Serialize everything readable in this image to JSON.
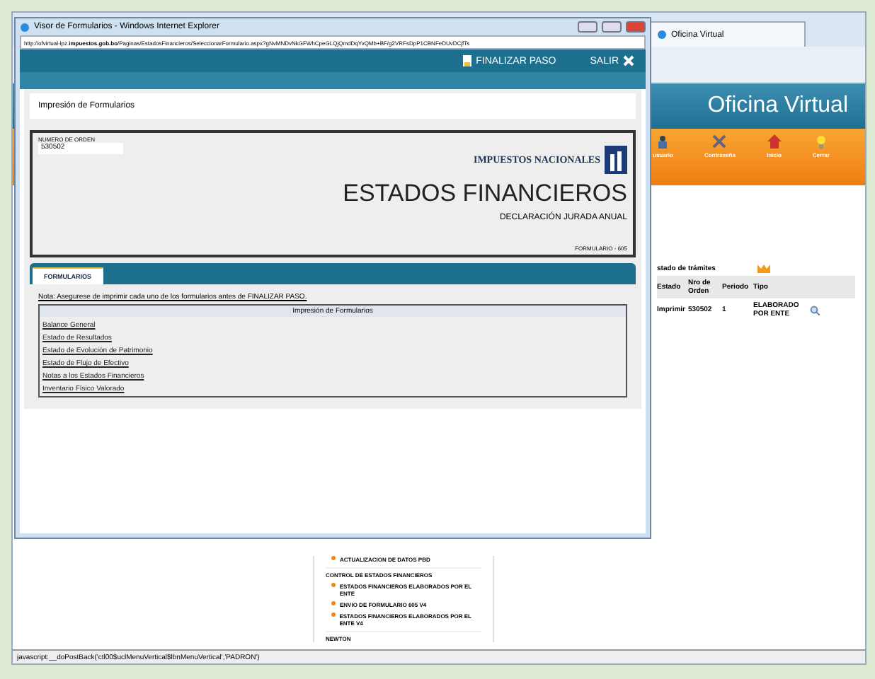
{
  "browser": {
    "tab": "Oficina Virtual",
    "banner": "Oficina Virtual",
    "menu": [
      {
        "label": "usuario",
        "kind": "user"
      },
      {
        "label": "Contraseña",
        "kind": "key"
      },
      {
        "label": "Inicio",
        "kind": "home"
      },
      {
        "label": "Cerrar",
        "kind": "exit"
      }
    ],
    "table": {
      "title": "stado de trámites",
      "columns": [
        "Estado",
        "Nro de Orden",
        "Periodo",
        "Tipo"
      ],
      "rows": [
        [
          "Imprimir",
          "530502",
          "1",
          "ELABORADO POR ENTE"
        ]
      ]
    },
    "sidebar": [
      {
        "label": "ACTUALIZACION DE DATOS PBD",
        "kind": "item"
      },
      {
        "label": "CONTROL DE ESTADOS FINANCIEROS",
        "kind": "header"
      },
      {
        "label": "ESTADOS FINANCIEROS ELABORADOS POR EL ENTE",
        "kind": "item"
      },
      {
        "label": "ENVIO DE FORMULARIO 605 V4",
        "kind": "item"
      },
      {
        "label": "ESTADOS FINANCIEROS ELABORADOS POR EL ENTE V4",
        "kind": "item"
      },
      {
        "label": "NEWTON",
        "kind": "header"
      }
    ],
    "status_bar": "javascript:__doPostBack('ctl00$uclMenuVertical$lbnMenuVertical','PADRON')"
  },
  "popup": {
    "title": "Visor de Formularios - Windows Internet Explorer",
    "address": "http://ofvirtual-lpz.**impuestos.gob.bo**/Paginas/EstadosFinancieros/SeleccionarFormulario.aspx?gNvMNDvNkGFWhCpeGLQjQmdDqYvQMb+BF/g2VRFsDpP1CBNFeDUvDCjfTs",
    "actions": [
      "FINALIZAR PASO",
      "SALIR"
    ],
    "panel_title": "Impresión de Formularios",
    "order_label": "NUMERO DE ORDEN",
    "order_value": "530502",
    "logo": "IMPUESTOS NACIONALES",
    "heading": "ESTADOS FINANCIEROS",
    "subheading": "DECLARACIÓN JURADA ANUAL",
    "form_code": "FORMULARIO - 605",
    "tabs": [
      {
        "label": "FORMULARIOS",
        "selected": true
      }
    ],
    "note": "Nota: Asegurese de imprimir cada uno de los formularios antes de FINALIZAR PASO.",
    "list_title": "Impresión de Formularios",
    "links": [
      "Balance General",
      "Estado de Resultados",
      "Estado de Evolución de Patrimonio",
      "Estado de Flujo de Efectivo",
      "Notas a los Estados Financieros",
      "Inventario Físico Valorado"
    ]
  }
}
